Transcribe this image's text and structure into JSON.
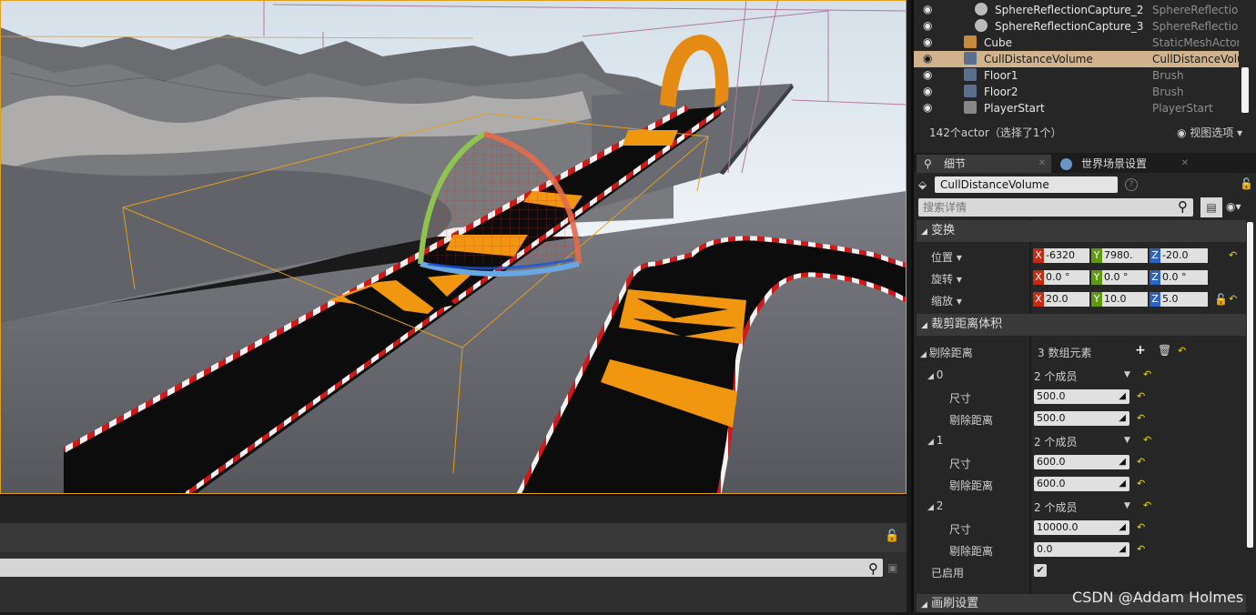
{
  "outliner": {
    "rows": [
      {
        "name": "SphereReflectionCapture_2",
        "type": "SphereReflection("
      },
      {
        "name": "SphereReflectionCapture_3",
        "type": "SphereReflection("
      },
      {
        "name": "Cube",
        "type": "StaticMeshActor"
      },
      {
        "name": "CullDistanceVolume",
        "type": "CullDistanceVolu"
      },
      {
        "name": "Floor1",
        "type": "Brush"
      },
      {
        "name": "Floor2",
        "type": "Brush"
      },
      {
        "name": "PlayerStart",
        "type": "PlayerStart"
      }
    ],
    "status": "142个actor（选择了1个）",
    "view_options": "视图选项"
  },
  "tabs": {
    "details": "细节",
    "world_settings": "世界场景设置"
  },
  "details": {
    "actor_name": "CullDistanceVolume",
    "search_placeholder": "搜索详情",
    "transform": {
      "header": "变换",
      "location_label": "位置",
      "rotation_label": "旋转",
      "scale_label": "缩放",
      "location": {
        "x": "-6320",
        "y": "7980.",
        "z": "-20.0"
      },
      "rotation": {
        "x": "0.0 °",
        "y": "0.0 °",
        "z": "0.0 °"
      },
      "scale": {
        "x": "20.0",
        "y": "10.0",
        "z": "5.0"
      }
    },
    "cull_volume": {
      "header": "裁剪距离体积",
      "distances_label": "剔除距离",
      "array_count": "3 数组元素",
      "members_text": "2 个成员",
      "size_label": "尺寸",
      "distance_label": "剔除距离",
      "entries": [
        {
          "index": "0",
          "size": "500.0",
          "distance": "500.0"
        },
        {
          "index": "1",
          "size": "600.0",
          "distance": "600.0"
        },
        {
          "index": "2",
          "size": "10000.0",
          "distance": "0.0"
        }
      ],
      "enabled_label": "已启用",
      "enabled": true
    },
    "brush_header": "画刷设置"
  },
  "watermark": "CSDN @Addam Holmes",
  "colors": {
    "axis_x": "#c62a12",
    "axis_y": "#5f9a12",
    "axis_z": "#2d62c0",
    "selection": "#d0b28c",
    "track_orange": "#f0960f"
  }
}
